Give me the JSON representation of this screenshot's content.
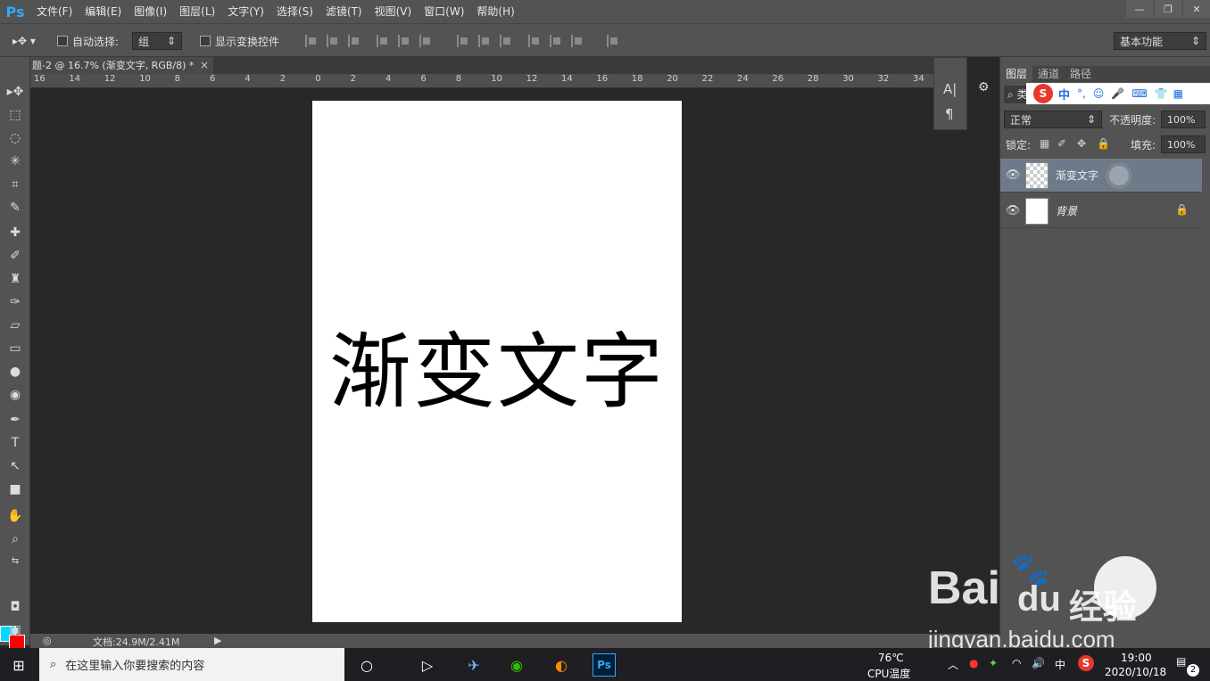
{
  "app": {
    "logo": "Ps"
  },
  "menu": [
    "文件(F)",
    "编辑(E)",
    "图像(I)",
    "图层(L)",
    "文字(Y)",
    "选择(S)",
    "滤镜(T)",
    "视图(V)",
    "窗口(W)",
    "帮助(H)"
  ],
  "options": {
    "auto_select_label": "自动选择:",
    "auto_select_value": "组",
    "show_transform_label": "显示变换控件",
    "workspace": "基本功能"
  },
  "document": {
    "tab_title": "题-2 @ 16.7% (渐变文字, RGB/8) *",
    "close": "×",
    "text": "渐变文字",
    "status": "文档:24.9M/2.41M"
  },
  "ruler_ticks": [
    "16",
    "14",
    "12",
    "10",
    "8",
    "6",
    "4",
    "2",
    "0",
    "2",
    "4",
    "6",
    "8",
    "10",
    "12",
    "14",
    "16",
    "18",
    "20",
    "22",
    "24",
    "26",
    "28",
    "30",
    "32",
    "34"
  ],
  "layers_panel": {
    "tabs": [
      "图层",
      "通道",
      "路径"
    ],
    "filter_label": "类",
    "blend_mode": "正常",
    "opacity_label": "不透明度:",
    "opacity_value": "100%",
    "lock_label": "锁定:",
    "fill_label": "填充:",
    "fill_value": "100%",
    "layers": [
      {
        "name": "渐变文字",
        "selected": true
      },
      {
        "name": "背景",
        "selected": false,
        "locked": true
      }
    ]
  },
  "ime": {
    "lang": "中"
  },
  "taskbar": {
    "search_placeholder": "在这里输入你要搜索的内容",
    "temp": "76℃",
    "temp_label": "CPU温度",
    "ime_lang": "中",
    "time": "19:00",
    "date": "2020/10/18",
    "notif_count": "2"
  },
  "watermark": {
    "brand": "Bai",
    "brand2": "du",
    "brand3": "经验",
    "url": "jingyan.baidu.com"
  },
  "colors": {
    "foreground": "#00d8ff",
    "background": "#ff0000",
    "ps_blue": "#31a8ff"
  }
}
